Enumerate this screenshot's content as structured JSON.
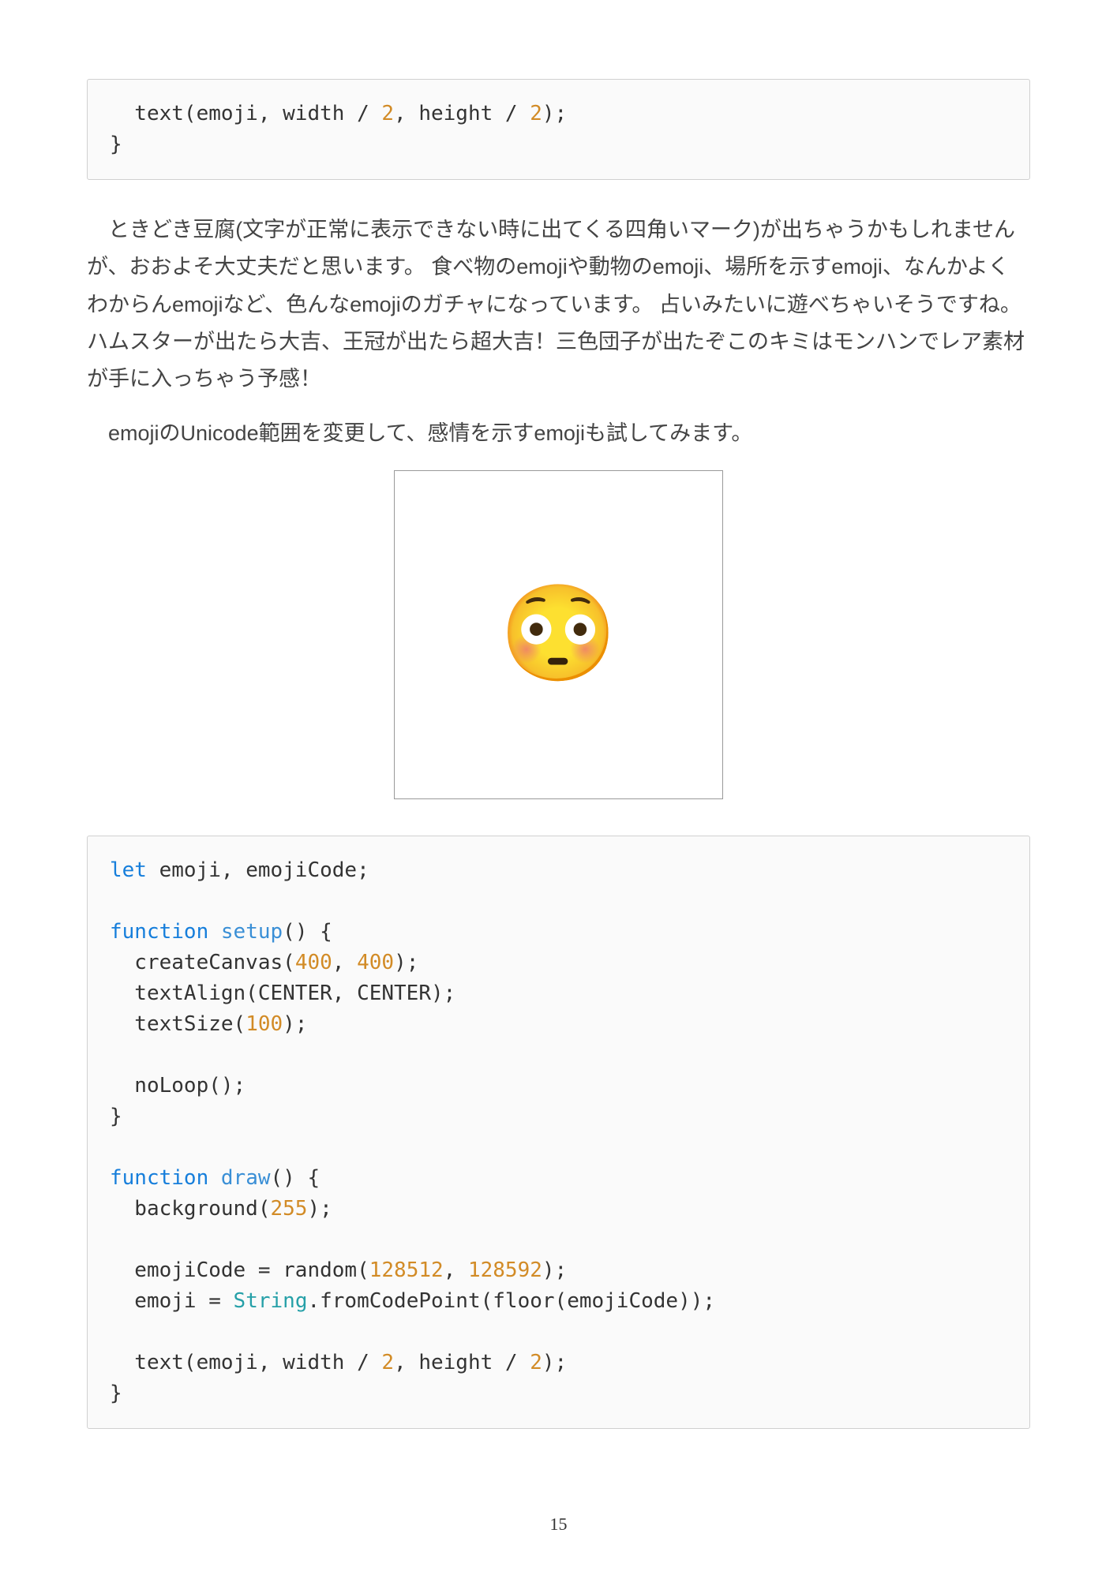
{
  "code1_html": "  text(emoji, width / <span class=\"tok-num\">2</span>, height / <span class=\"tok-num\">2</span>);\n}",
  "para1": "ときどき豆腐(文字が正常に表示できない時に出てくる四角いマーク)が出ちゃうかもしれませんが、おおよそ大丈夫だと思います。 食べ物のemojiや動物のemoji、場所を示すemoji、なんかよくわからんemojiなど、色んなemojiのガチャになっています。 占いみたいに遊べちゃいそうですね。 ハムスターが出たら大吉、王冠が出たら超大吉！三色団子が出たぞこのキミはモンハンでレア素材が手に入っちゃう予感！",
  "para2": "emojiのUnicode範囲を変更して、感情を示すemojiも試してみます。",
  "emoji_char": "😳",
  "code2_html": "<span class=\"tok-kw\">let</span> emoji, emojiCode;\n\n<span class=\"tok-kw\">function</span> <span class=\"tok-fn\">setup</span>() {\n  createCanvas(<span class=\"tok-num\">400</span>, <span class=\"tok-num\">400</span>);\n  textAlign(CENTER, CENTER);\n  textSize(<span class=\"tok-num\">100</span>);\n\n  noLoop();\n}\n\n<span class=\"tok-kw\">function</span> <span class=\"tok-fn\">draw</span>() {\n  background(<span class=\"tok-num\">255</span>);\n\n  emojiCode = random(<span class=\"tok-num\">128512</span>, <span class=\"tok-num\">128592</span>);\n  emoji = <span class=\"tok-type\">String</span>.fromCodePoint(floor(emojiCode));\n\n  text(emoji, width / <span class=\"tok-num\">2</span>, height / <span class=\"tok-num\">2</span>);\n}",
  "page_number": "15"
}
